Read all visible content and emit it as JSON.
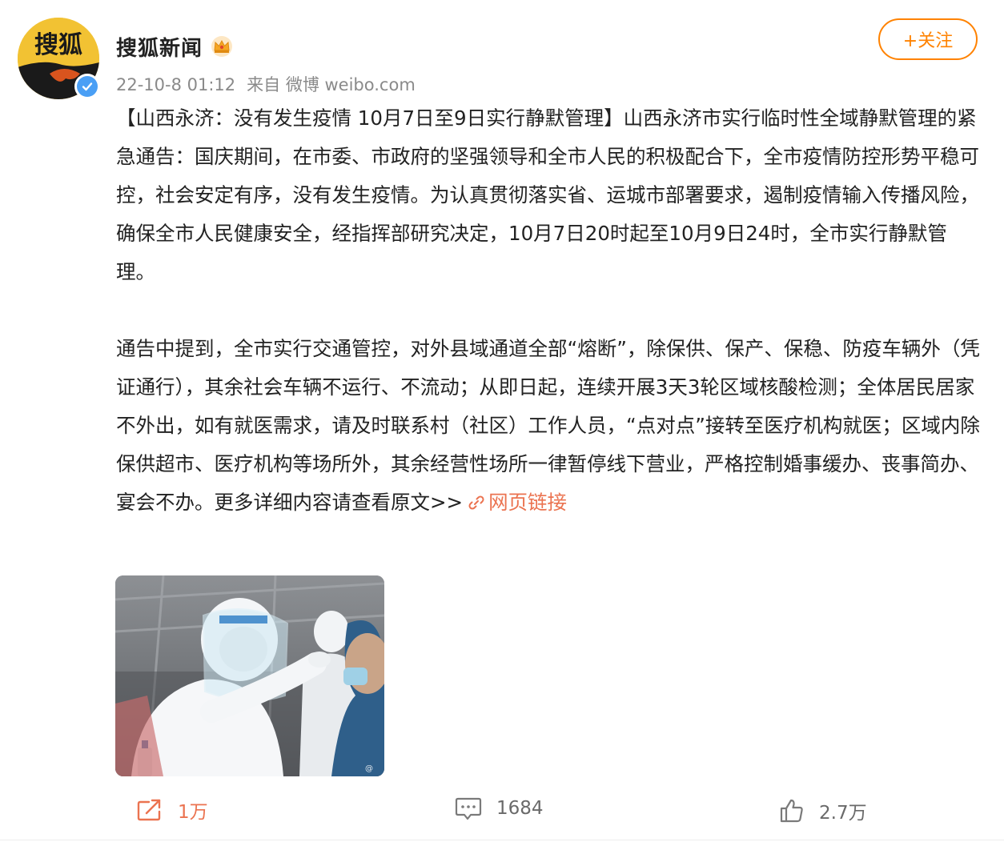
{
  "author": {
    "name": "搜狐新闻",
    "avatar_text": "搜狐",
    "badge": "crown-icon",
    "verified": true
  },
  "meta": {
    "time": "22-10-8 01:12",
    "source": "来自 微博 weibo.com"
  },
  "follow_button": "+关注",
  "post": {
    "paragraph1": "【山西永济：没有发生疫情 10月7日至9日实行静默管理】山西永济市实行临时性全域静默管理的紧急通告：国庆期间，在市委、市政府的坚强领导和全市人民的积极配合下，全市疫情防控形势平稳可控，社会安定有序，没有发生疫情。为认真贯彻落实省、运城市部署要求，遏制疫情输入传播风险，确保全市人民健康安全，经指挥部研究决定，10月7日20时起至10月9日24时，全市实行静默管理。",
    "paragraph2": "通告中提到，全市实行交通管控，对外县域通道全部“熔断”，除保供、保产、保稳、防疫车辆外（凭证通行），其余社会车辆不运行、不流动；从即日起，连续开展3天3轮区域核酸检测；全体居民居家不外出，如有就医需求，请及时联系村（社区）工作人员，“点对点”接转至医疗机构就医；区域内除保供超市、医疗机构等场所外，其余经营性场所一律暂停线下营业，严格控制婚事缓办、丧事简办、宴会不办。更多详细内容请查看原文>>",
    "link_label": "网页链接"
  },
  "image": {
    "alt": "核酸检测"
  },
  "actions": {
    "repost": "1万",
    "comment": "1684",
    "like": "2.7万"
  },
  "colors": {
    "accent": "#ff8200",
    "link": "#eb7350",
    "meta": "#8a8a8a",
    "verified": "#4a9ff5"
  }
}
